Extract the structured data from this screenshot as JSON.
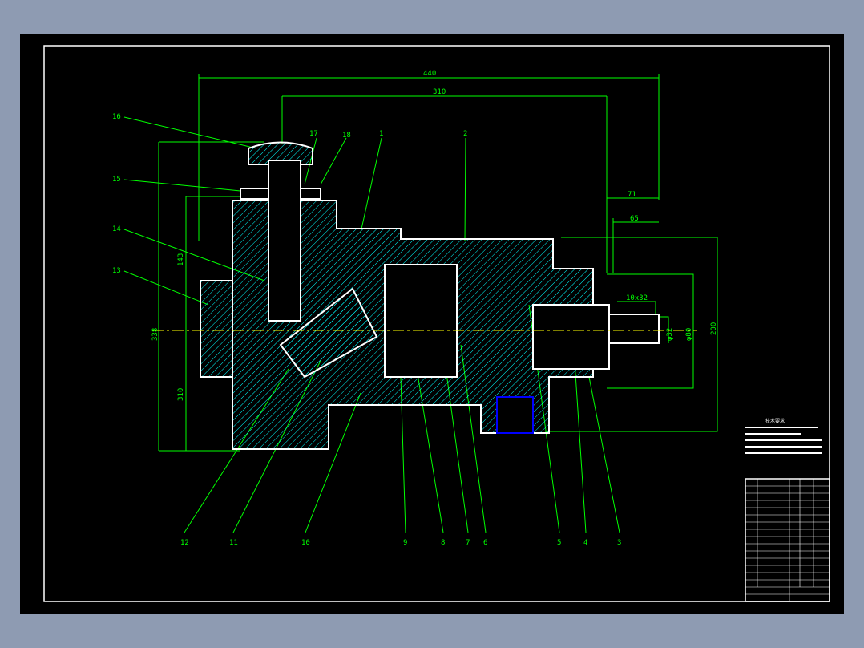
{
  "drawing": {
    "dimensions": {
      "overall_length": "440",
      "body_length": "310",
      "shaft_71": "71",
      "shaft_65": "65",
      "key": "10x32",
      "shaft_dia": "φ32",
      "flange_dia": "φ80",
      "height_right": "200",
      "height_left": "338",
      "upper_height": "143",
      "lower_height": "310"
    },
    "part_numbers_top": [
      "16",
      "15",
      "14",
      "13",
      "17",
      "18",
      "1",
      "2"
    ],
    "part_numbers_bottom": [
      "12",
      "11",
      "10",
      "9",
      "8",
      "7",
      "6",
      "5",
      "4",
      "3"
    ],
    "notes_title": "技术要求",
    "colors": {
      "outline": "#ffffff",
      "hatch": "#00ffff",
      "dimension": "#00ff00",
      "centerline": "#ffff00",
      "background": "#000000"
    }
  }
}
